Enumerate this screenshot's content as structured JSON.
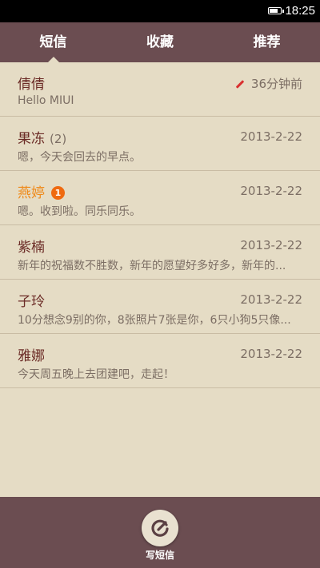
{
  "status": {
    "time": "18:25",
    "battery_level": 0.8
  },
  "tabs": [
    {
      "label": "短信",
      "active": true
    },
    {
      "label": "收藏",
      "active": false
    },
    {
      "label": "推荐",
      "active": false
    }
  ],
  "messages": [
    {
      "name": "倩倩",
      "date": "36分钟前",
      "preview": "Hello MIUI",
      "draft": true
    },
    {
      "name": "果冻",
      "count": "(2)",
      "date": "2013-2-22",
      "preview": "嗯，今天会回去的早点。"
    },
    {
      "name": "燕婷",
      "badge": "1",
      "date": "2013-2-22",
      "preview": "嗯。收到啦。同乐同乐。",
      "unread": true
    },
    {
      "name": "紫楠",
      "date": "2013-2-22",
      "preview": "新年的祝福数不胜数，新年的愿望好多好多，新年的..."
    },
    {
      "name": "子玲",
      "date": "2013-2-22",
      "preview": "10分想念9别的你，8张照片7张是你，6只小狗5只像..."
    },
    {
      "name": "雅娜",
      "date": "2013-2-22",
      "preview": "今天周五晚上去团建吧，走起！"
    }
  ],
  "compose": {
    "label": "写短信"
  },
  "colors": {
    "accent": "#6b4d51",
    "background": "#e5dcc5",
    "name": "#6b2b26",
    "unread_name": "#ef8a1a",
    "badge": "#ef6a10"
  }
}
